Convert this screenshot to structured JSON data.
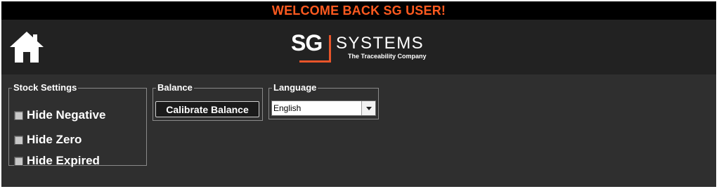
{
  "welcome": {
    "text": "WELCOME BACK SG USER!"
  },
  "header": {
    "home_icon": "home-icon",
    "logo": {
      "sg": "SG",
      "systems": "SYSTEMS",
      "tagline": "The Traceability Company"
    }
  },
  "stock_settings": {
    "legend": "Stock Settings",
    "options": [
      {
        "label": "Hide Negative",
        "checked": false
      },
      {
        "label": "Hide Zero",
        "checked": false
      },
      {
        "label": "Hide Expired",
        "checked": false
      }
    ]
  },
  "balance": {
    "legend": "Balance",
    "button_label": "Calibrate Balance"
  },
  "language": {
    "legend": "Language",
    "selected": "English"
  },
  "colors": {
    "accent": "#ff5a1f",
    "logo_accent": "#e8552a",
    "header_bg": "#222222",
    "panel_bg": "#2f2f2f",
    "top_bar_bg": "#000000"
  }
}
